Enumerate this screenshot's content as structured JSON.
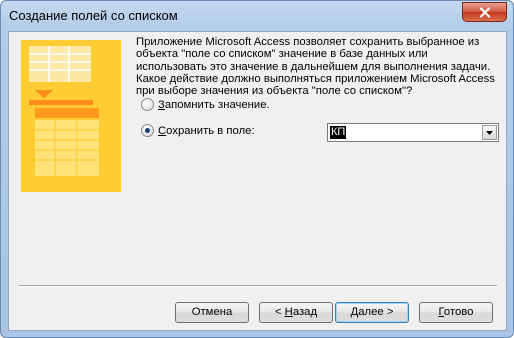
{
  "window": {
    "title": "Создание полей со списком"
  },
  "description": "Приложение Microsoft Access позволяет сохранить выбранное из объекта \"поле со списком\" значение в базе данных или использовать это значение в дальнейшем для выполнения задачи. Какое действие должно выполняться приложением Microsoft Access при выборе значения из объекта \"поле со списком\"?",
  "options": {
    "remember": {
      "label_prefix": "З",
      "label_rest": "апомнить значение.",
      "checked": false
    },
    "save": {
      "label_prefix": "С",
      "label_rest": "охранить в поле:",
      "checked": true
    }
  },
  "field_select": {
    "value": "КП"
  },
  "buttons": {
    "cancel": "Отмена",
    "back_prefix": "< ",
    "back_hotkey": "Н",
    "back_rest": "азад",
    "next_hotkey": "Д",
    "next_rest": "алее >",
    "finish_hotkey": "Г",
    "finish_rest": "отово"
  },
  "colors": {
    "illustration": "#ffcc33",
    "title_bar": "#b9d1ea",
    "close_button": "#c4361c"
  }
}
